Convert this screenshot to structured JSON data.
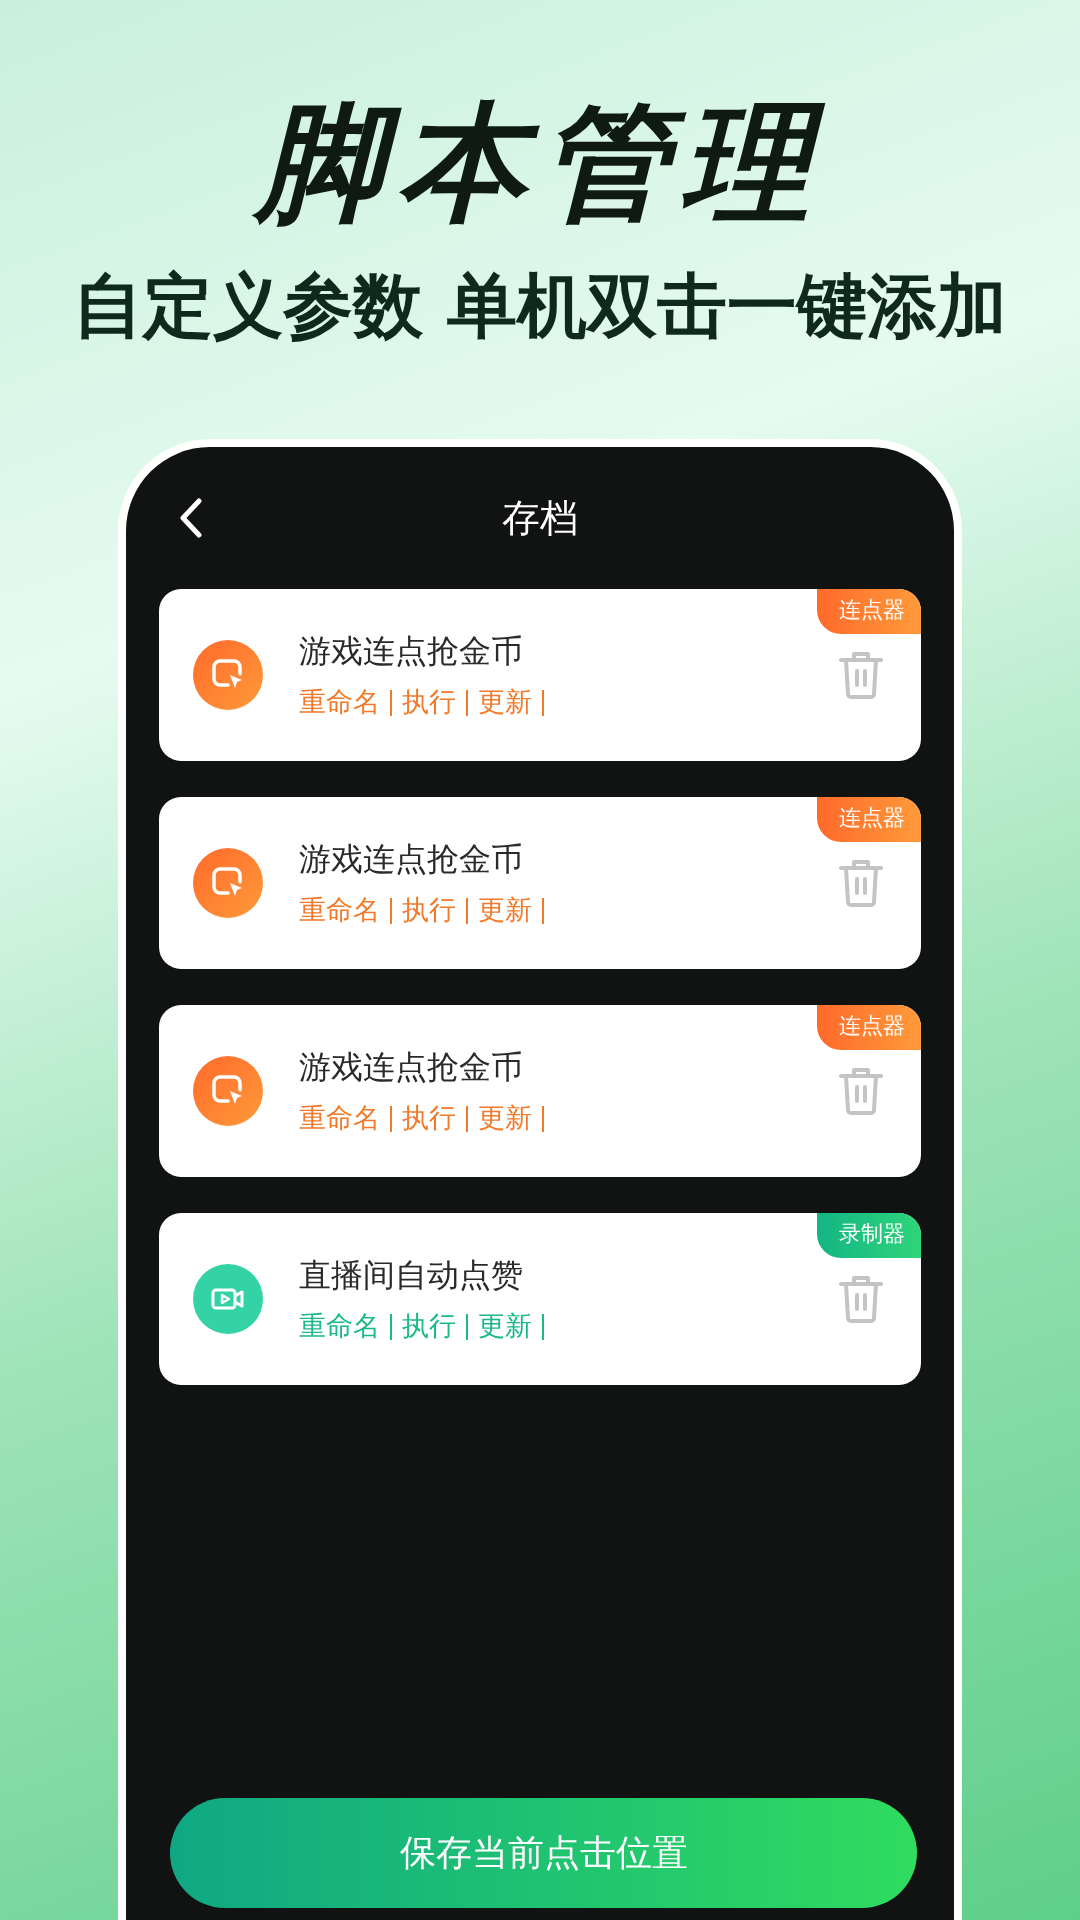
{
  "headline": "脚本管理",
  "subtitle": "自定义参数 单机双击一键添加",
  "screen": {
    "title": "存档",
    "scripts": [
      {
        "kind": "clicker",
        "name": "游戏连点抢金币",
        "tag": "连点器",
        "actions": [
          "重命名",
          "执行",
          "更新"
        ]
      },
      {
        "kind": "clicker",
        "name": "游戏连点抢金币",
        "tag": "连点器",
        "actions": [
          "重命名",
          "执行",
          "更新"
        ]
      },
      {
        "kind": "clicker",
        "name": "游戏连点抢金币",
        "tag": "连点器",
        "actions": [
          "重命名",
          "执行",
          "更新"
        ]
      },
      {
        "kind": "recorder",
        "name": "直播间自动点赞",
        "tag": "录制器",
        "actions": [
          "重命名",
          "执行",
          "更新"
        ]
      }
    ],
    "save_button": "保存当前点击位置"
  }
}
